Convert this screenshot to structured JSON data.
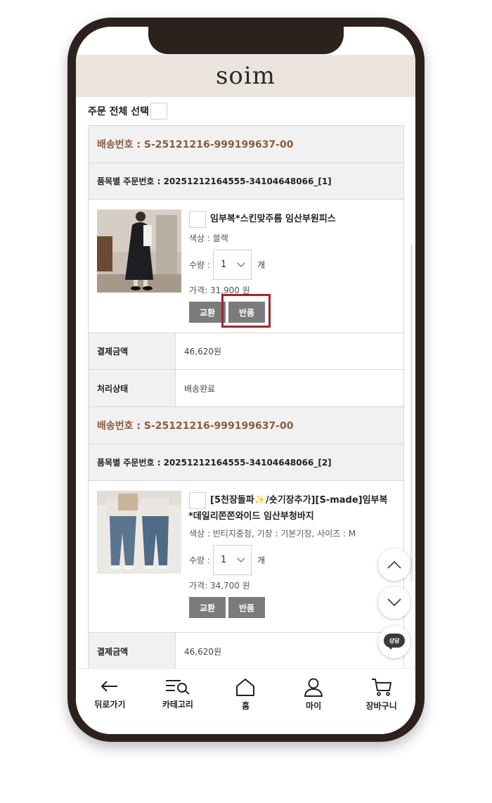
{
  "app": {
    "logo": "soim"
  },
  "header": {
    "select_all_label": "주문 전체 선택"
  },
  "orders": [
    {
      "shipping_no": "배송번호 : S-25121216-999199637-00",
      "item_order_no": "품목별 주문번호 : 20251212164555-34104648066_[1]",
      "product": {
        "name": "임부복*스킨맞주름 임산부원피스",
        "option": "색상 : 블랙",
        "qty_label": "수량 :",
        "qty_value": "1",
        "qty_unit": "개",
        "price": "가격: 31,900 원",
        "exchange_label": "교환",
        "return_label": "반품"
      },
      "rows": [
        {
          "key": "결제금액",
          "value": "46,620원"
        },
        {
          "key": "처리상태",
          "value": "배송완료"
        }
      ]
    },
    {
      "shipping_no": "배송번호 : S-25121216-999199637-00",
      "item_order_no": "품목별 주문번호 : 20251212164555-34104648066_[2]",
      "product": {
        "name_line1": "[5천장돌파✨/숏기장추가][S-made]임부복",
        "name_line2": "*데일리쫀쫀와이드 임산부청바지",
        "option": "색상 : 빈티지중청, 기장 : 기본기장, 사이즈 : M",
        "qty_label": "수량 :",
        "qty_value": "1",
        "qty_unit": "개",
        "price": "가격: 34,700 원",
        "exchange_label": "교환",
        "return_label": "반품"
      },
      "rows": [
        {
          "key": "결제금액",
          "value": "46,620원"
        }
      ]
    }
  ],
  "floating": {
    "chat_label": "상담"
  },
  "nav": [
    {
      "label": "뒤로가기",
      "icon": "back-arrow-icon"
    },
    {
      "label": "카테고리",
      "icon": "category-search-icon"
    },
    {
      "label": "홈",
      "icon": "home-icon"
    },
    {
      "label": "마이",
      "icon": "user-icon"
    },
    {
      "label": "장바구니",
      "icon": "cart-icon"
    }
  ],
  "colors": {
    "frame": "#2d211e",
    "header_bg": "#ebe4dc",
    "shipping_text": "#8a5c3e",
    "button_bg": "#7b7b7b",
    "highlight": "#a5242a"
  }
}
